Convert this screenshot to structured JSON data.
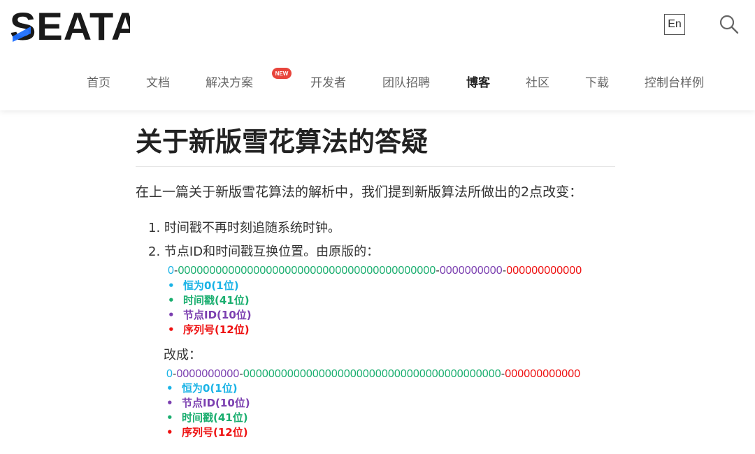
{
  "header": {
    "logo_text": "SEATA",
    "lang_button": "En",
    "search_icon": "search-icon",
    "nav": [
      {
        "label": "首页",
        "active": false
      },
      {
        "label": "文档",
        "active": false
      },
      {
        "label": "解决方案",
        "active": false,
        "badge": "NEW"
      },
      {
        "label": "开发者",
        "active": false
      },
      {
        "label": "团队招聘",
        "active": false
      },
      {
        "label": "博客",
        "active": true
      },
      {
        "label": "社区",
        "active": false
      },
      {
        "label": "下载",
        "active": false
      },
      {
        "label": "控制台样例",
        "active": false
      }
    ]
  },
  "article": {
    "title": "关于新版雪花算法的答疑",
    "intro": "在上一篇关于新版雪花算法的解析中，我们提到新版算法所做出的2点改变：",
    "list": [
      "1. 时间戳不再时刻追随系统时钟。",
      "2. 节点ID和时间戳互换位置。由原版的："
    ],
    "original_layout": {
      "segments": {
        "sign": "0",
        "timestamp": "00000000000000000000000000000000000000000",
        "node": "0000000000",
        "sequence": "000000000000",
        "dash": "-"
      },
      "legend": [
        {
          "text": "恒为0(1位)",
          "kind": "sign"
        },
        {
          "text": "时间戳(41位)",
          "kind": "timestamp"
        },
        {
          "text": "节点ID(10位)",
          "kind": "node"
        },
        {
          "text": "序列号(12位)",
          "kind": "sequence"
        }
      ]
    },
    "change_label": "改成：",
    "new_layout": {
      "segments": {
        "sign": "0",
        "node": "0000000000",
        "timestamp": "00000000000000000000000000000000000000000",
        "sequence": "000000000000",
        "dash": "-"
      },
      "legend": [
        {
          "text": "恒为0(1位)",
          "kind": "sign"
        },
        {
          "text": "节点ID(10位)",
          "kind": "node"
        },
        {
          "text": "时间戳(41位)",
          "kind": "timestamp"
        },
        {
          "text": "序列号(12位)",
          "kind": "sequence"
        }
      ]
    },
    "bullet_char": "•"
  },
  "colors": {
    "sign": "#1ab3e6",
    "timestamp": "#1aae6f",
    "node": "#7b3fb0",
    "sequence": "#ee1111",
    "badge": "#e8453c",
    "logo": "#1a1a1a",
    "logo_accent": "#1e6fff"
  }
}
